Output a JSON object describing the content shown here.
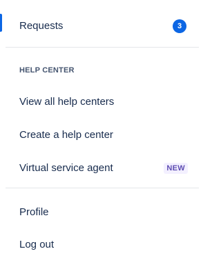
{
  "menu": {
    "requests": {
      "label": "Requests",
      "count": "3"
    },
    "help_center": {
      "heading": "HELP CENTER",
      "view_all_label": "View all help centers",
      "create_label": "Create a help center",
      "virtual_agent_label": "Virtual service agent",
      "virtual_agent_badge": "NEW"
    },
    "profile_label": "Profile",
    "logout_label": "Log out"
  },
  "colors": {
    "accent": "#0c66e4",
    "text": "#172b4d",
    "heading": "#44546f",
    "new_badge_bg": "#f3f0ff",
    "new_badge_text": "#5e4db2"
  }
}
